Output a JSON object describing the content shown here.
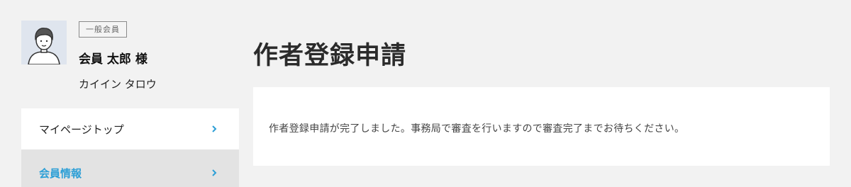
{
  "profile": {
    "badge": "一般会員",
    "name": "会員 太郎 様",
    "kana": "カイイン タロウ"
  },
  "nav": {
    "items": [
      {
        "label": "マイページトップ",
        "active": false
      },
      {
        "label": "会員情報",
        "active": true
      }
    ]
  },
  "main": {
    "title": "作者登録申請",
    "message": "作者登録申請が完了しました。事務局で審査を行いますので審査完了までお待ちください。"
  },
  "colors": {
    "accent": "#2d9fd6",
    "background": "#f2f2f2",
    "active_nav_bg": "#e3e3e3"
  }
}
